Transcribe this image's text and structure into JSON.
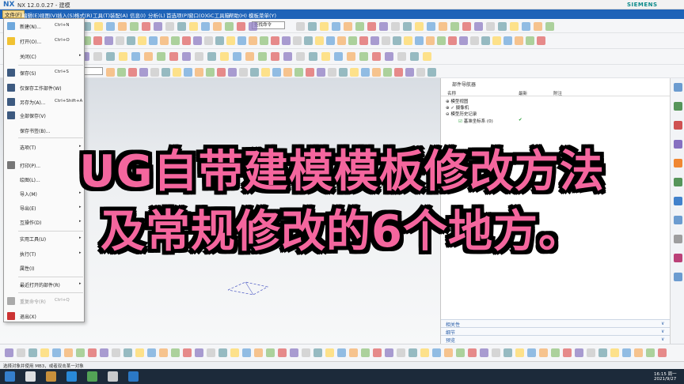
{
  "window": {
    "logo": "NX",
    "title": "NX 12.0.0.27 - 建模",
    "brand": "SIEMENS"
  },
  "menubar": {
    "items": [
      "文件(F)",
      "编辑(E)",
      "视图(V)",
      "插入(S)",
      "格式(R)",
      "工具(T)",
      "装配(A)",
      "信息(I)",
      "分析(L)",
      "首选项(P)",
      "窗口(O)",
      "GC工具箱",
      "帮助(H)",
      "模板菜单(Y)"
    ],
    "search_placeholder": "查找命令"
  },
  "file_menu": {
    "items": [
      {
        "label": "新建(N)...",
        "shortcut": "Ctrl+N",
        "icon": "new-file-icon",
        "color": "#6fa8dc"
      },
      {
        "label": "打开(O)...",
        "shortcut": "Ctrl+O",
        "icon": "open-folder-icon",
        "color": "#f1c232"
      },
      {
        "label": "关闭(C)",
        "shortcut": "",
        "icon": "",
        "arrow": "▸"
      },
      {
        "label": "保存(S)",
        "shortcut": "Ctrl+S",
        "icon": "save-icon",
        "color": "#3d5a80"
      },
      {
        "label": "仅保存工作部件(W)",
        "shortcut": "",
        "icon": "save-work-part-icon",
        "color": "#3d5a80"
      },
      {
        "label": "另存为(A)...",
        "shortcut": "Ctrl+Shift+A",
        "icon": "save-as-icon",
        "color": "#3d5a80"
      },
      {
        "label": "全部保存(V)",
        "shortcut": "",
        "icon": "save-all-icon",
        "color": "#3d5a80"
      },
      {
        "label": "保存书签(B)...",
        "shortcut": "",
        "icon": ""
      },
      {
        "label": "选项(T)",
        "shortcut": "",
        "icon": "",
        "arrow": "▸"
      },
      {
        "label": "打印(P)...",
        "shortcut": "",
        "icon": "print-icon",
        "color": "#777777"
      },
      {
        "label": "绘图(L)...",
        "shortcut": "",
        "icon": ""
      },
      {
        "label": "导入(M)",
        "shortcut": "",
        "icon": "",
        "arrow": "▸"
      },
      {
        "label": "导出(E)",
        "shortcut": "",
        "icon": "",
        "arrow": "▸"
      },
      {
        "label": "互操作(D)",
        "shortcut": "",
        "icon": "",
        "arrow": "▸"
      },
      {
        "label": "实用工具(U)",
        "shortcut": "",
        "icon": "",
        "arrow": "▸"
      },
      {
        "label": "执行(T)",
        "shortcut": "",
        "icon": "",
        "arrow": "▸"
      },
      {
        "label": "属性(I)",
        "shortcut": "",
        "icon": ""
      },
      {
        "label": "最近打开的部件(R)",
        "shortcut": "",
        "icon": "",
        "arrow": "▸"
      },
      {
        "label": "重复命令(R)",
        "shortcut": "Ctrl+Q",
        "icon": "repeat-command-icon",
        "color": "#aaaaaa",
        "disabled": true
      },
      {
        "label": "退出(X)",
        "shortcut": "",
        "icon": "exit-icon",
        "color": "#cc3333"
      }
    ]
  },
  "navigator": {
    "title": "部件导航器",
    "columns": [
      "名称",
      "最新",
      "附注"
    ],
    "rows": [
      {
        "prefix": "⊕",
        "label": "模型视图",
        "check": ""
      },
      {
        "prefix": "⊕ ✓",
        "label": "摄像机",
        "check": ""
      },
      {
        "prefix": "⊖",
        "label": "模型历史记录",
        "check": ""
      },
      {
        "prefix": "☑",
        "label": "基准坐标系 (0)",
        "check": "✔"
      }
    ],
    "panels": [
      "相关性",
      "细节",
      "预览"
    ]
  },
  "statusbar": {
    "text": "选择对象并使用 MB3，或者双击某一对象"
  },
  "taskbar": {
    "time": "16:15 周一",
    "date": "2021/9/27"
  },
  "caption": {
    "line1": "UG自带建模模板修改方法",
    "line2": "及常规修改的6个地方。"
  },
  "colors": {
    "menubar": "#1e63b8",
    "caption_fill": "#f4669e",
    "caption_outline": "#000000"
  }
}
